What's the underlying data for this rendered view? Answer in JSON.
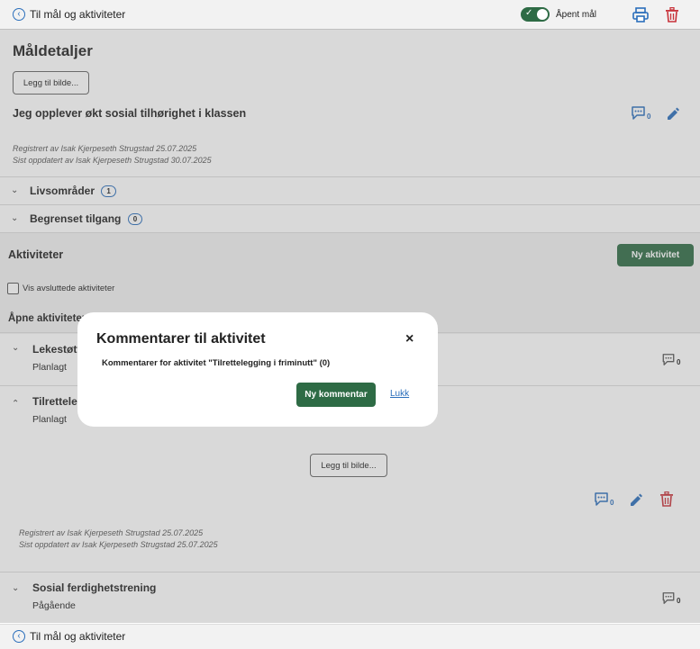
{
  "topbar": {
    "back_label": "Til mål og aktiviteter",
    "toggle_label": "Åpent mål",
    "toggle_on": true
  },
  "header": {
    "title": "Måldetaljer",
    "add_image_label": "Legg til bilde..."
  },
  "goal": {
    "text": "Jeg opplever økt sosial tilhørighet i klassen",
    "comment_count": "0",
    "registered": "Registrert av Isak Kjerpeseth Strugstad 25.07.2025",
    "updated": "Sist oppdatert av Isak Kjerpeseth Strugstad 30.07.2025"
  },
  "sections": [
    {
      "label": "Livsområder",
      "count": "1"
    },
    {
      "label": "Begrenset tilgang",
      "count": "0"
    }
  ],
  "activities": {
    "title": "Aktiviteter",
    "new_button": "Ny aktivitet",
    "show_finished_label": "Vis avsluttede aktiviteter",
    "open_label": "Åpne aktiviteter",
    "items": [
      {
        "title": "Lekestøtte",
        "status": "Planlagt",
        "comment_count": "0"
      },
      {
        "title": "Tilrettelegging i friminutt",
        "status": "Planlagt",
        "comment_count": "0",
        "add_image_label": "Legg til bilde...",
        "registered": "Registrert av Isak Kjerpeseth Strugstad 25.07.2025",
        "updated": "Sist oppdatert av Isak Kjerpeseth Strugstad 25.07.2025"
      },
      {
        "title": "Sosial ferdighetstrening",
        "status": "Pågående",
        "comment_count": "0"
      }
    ]
  },
  "footer": {
    "back_label": "Til mål og aktiviteter"
  },
  "modal": {
    "title": "Kommentarer til aktivitet",
    "close_symbol": "×",
    "subtitle": "Kommentarer for aktivitet \"Tilrettelegging i friminutt\" (0)",
    "new_comment_button": "Ny kommentar",
    "close_link": "Lukk"
  },
  "colors": {
    "accent_green": "#2e6b45",
    "link_blue": "#2a6ebb",
    "delete_red": "#c8323a"
  }
}
